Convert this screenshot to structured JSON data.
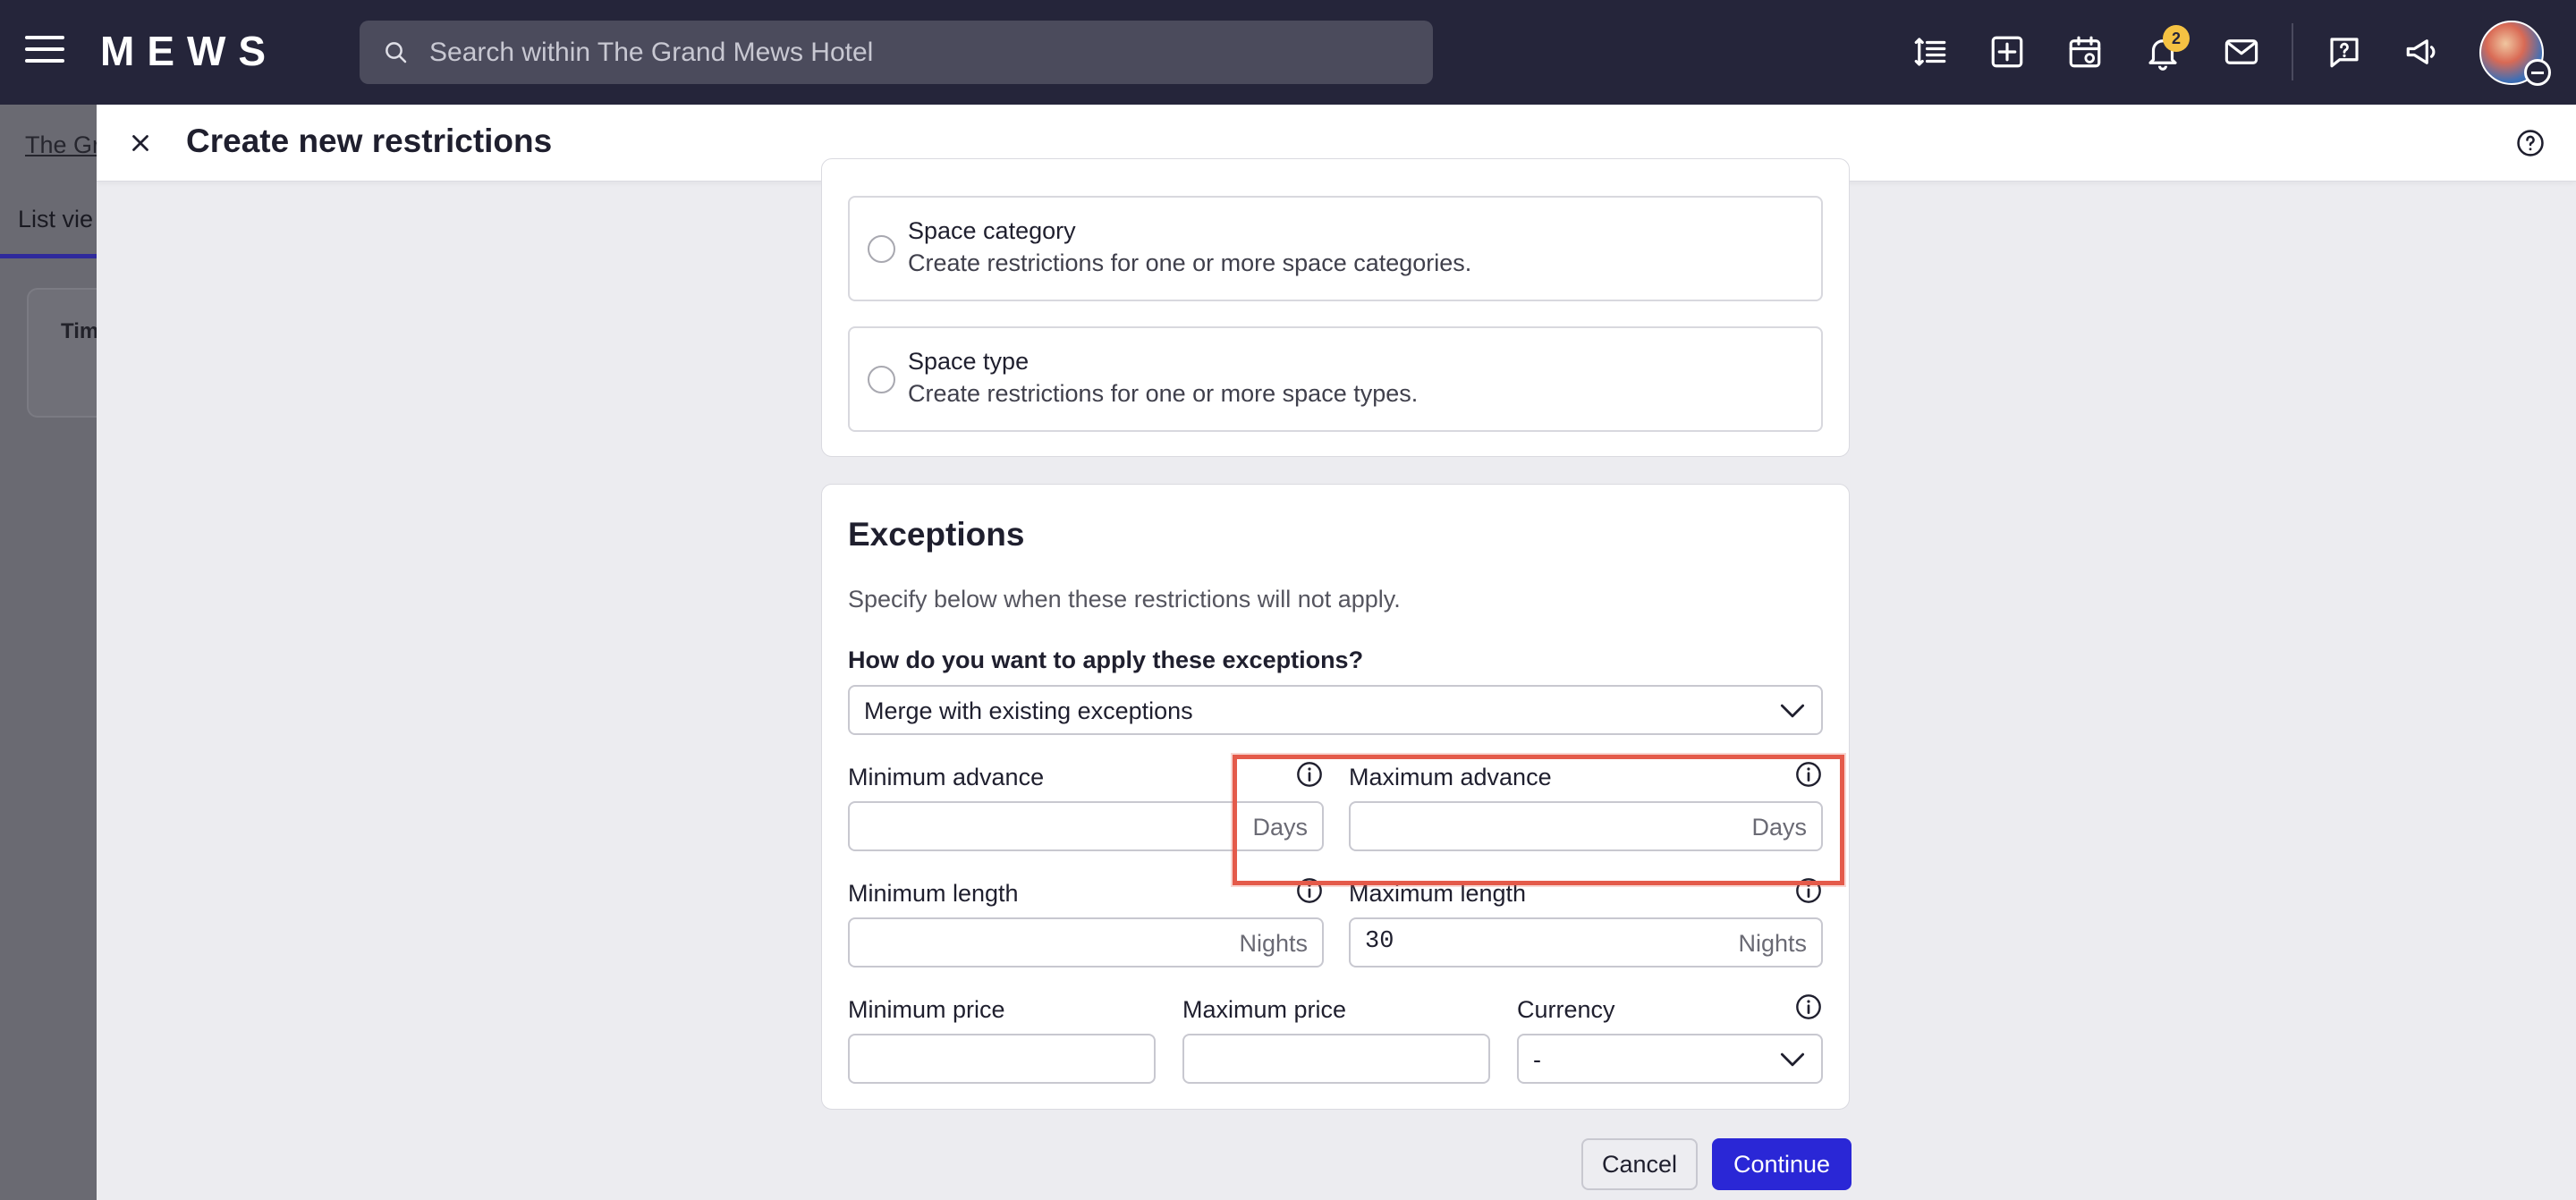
{
  "app": {
    "logo": "MEWS",
    "search_placeholder": "Search within The Grand Mews Hotel",
    "notification_count": "2"
  },
  "background": {
    "breadcrumb": "The Gr",
    "tab": "List vie",
    "card_label": "Tim"
  },
  "modal": {
    "title": "Create new restrictions",
    "options": [
      {
        "title": "Space category",
        "description": "Create restrictions for one or more space categories."
      },
      {
        "title": "Space type",
        "description": "Create restrictions for one or more space types."
      }
    ],
    "exceptions": {
      "title": "Exceptions",
      "description": "Specify below when these restrictions will not apply.",
      "apply_question": "How do you want to apply these exceptions?",
      "apply_value": "Merge with existing exceptions",
      "min_advance": {
        "label": "Minimum advance",
        "value": "",
        "unit": "Days"
      },
      "max_advance": {
        "label": "Maximum advance",
        "value": "",
        "unit": "Days"
      },
      "min_length": {
        "label": "Minimum length",
        "value": "",
        "unit": "Nights"
      },
      "max_length": {
        "label": "Maximum length",
        "value": "30",
        "unit": "Nights"
      },
      "min_price": {
        "label": "Minimum price",
        "value": ""
      },
      "max_price": {
        "label": "Maximum price",
        "value": ""
      },
      "currency": {
        "label": "Currency",
        "value": "-"
      }
    },
    "cancel_label": "Cancel",
    "continue_label": "Continue"
  },
  "colors": {
    "topbar": "#25253a",
    "primary": "#2a27d6",
    "highlight": "#e45a4a",
    "badge": "#f5c243"
  }
}
